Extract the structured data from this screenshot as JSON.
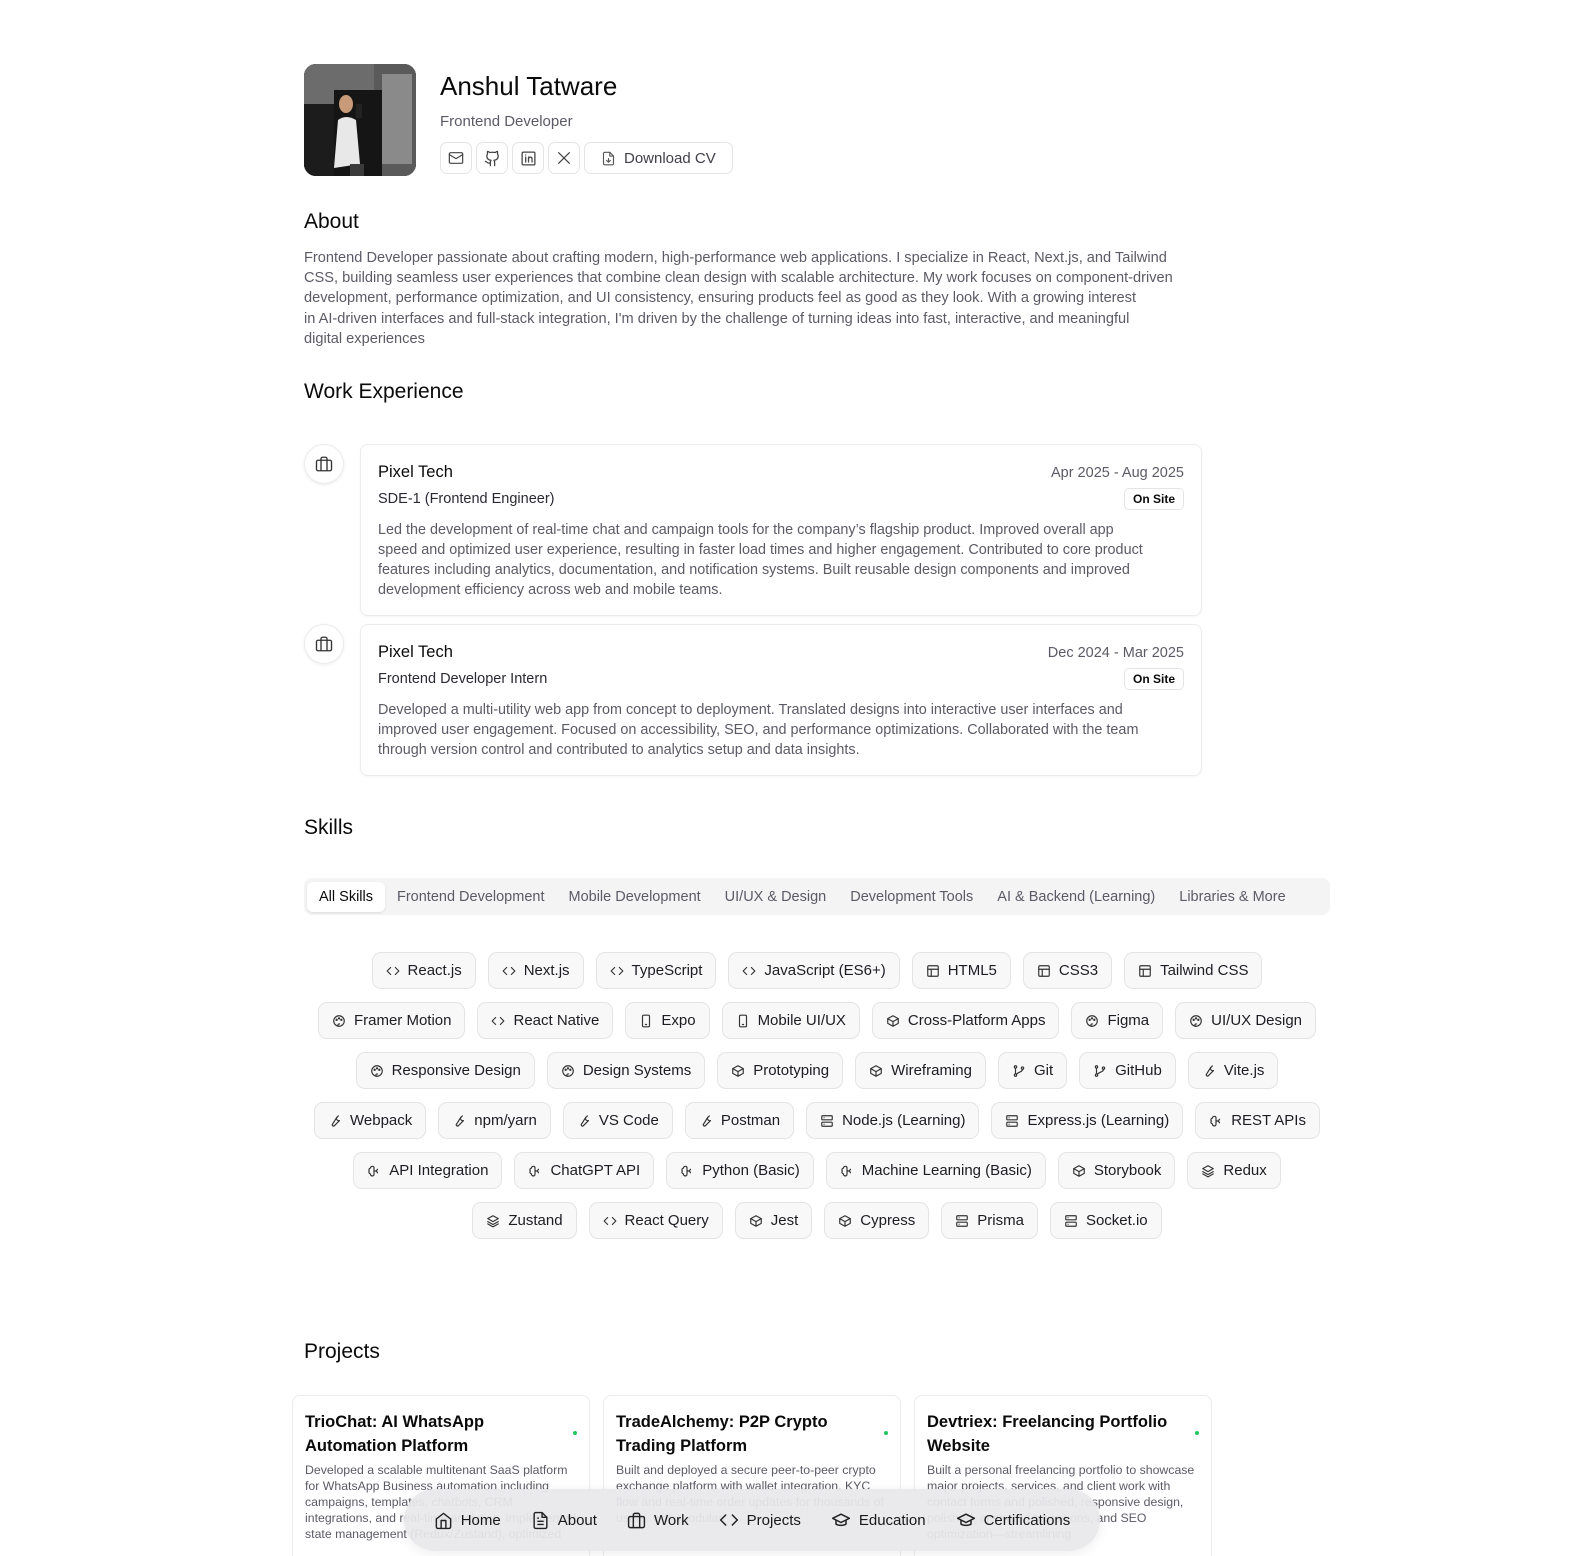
{
  "profile": {
    "name": "Anshul Tatware",
    "role": "Frontend Developer",
    "download_cv": "Download CV",
    "social_icons": [
      "mail-icon",
      "github-icon",
      "linkedin-icon",
      "x-icon"
    ]
  },
  "about": {
    "title": "About",
    "text": "Frontend Developer passionate about crafting modern, high-performance web applications. I specialize in React, Next.js, and Tailwind\nCSS, building seamless user experiences that combine clean design with scalable architecture. My work focuses on component-driven\ndevelopment, performance optimization, and UI consistency, ensuring products feel as good as they look. With a growing interest\nin AI-driven interfaces and full-stack integration, I'm driven by the challenge of turning ideas into fast, interactive, and meaningful\ndigital experiences"
  },
  "work": {
    "title": "Work Experience",
    "items": [
      {
        "company": "Pixel Tech",
        "dates": "Apr 2025 - Aug 2025",
        "position": "SDE-1 (Frontend Engineer)",
        "badge": "On Site",
        "description": "Led the development of real-time chat and campaign tools for the company’s flagship product. Improved overall app\nspeed and optimized user experience, resulting in faster load times and higher engagement. Contributed to core product\nfeatures including analytics, documentation, and notification systems. Built reusable design components and improved\ndevelopment efficiency across web and mobile teams."
      },
      {
        "company": "Pixel Tech",
        "dates": "Dec 2024 - Mar 2025",
        "position": "Frontend Developer Intern",
        "badge": "On Site",
        "description": "Developed a multi-utility web app from concept to deployment. Translated designs into interactive user interfaces and\nimproved user engagement. Focused on accessibility, SEO, and performance optimizations. Collaborated with the team\nthrough version control and contributed to analytics setup and data insights."
      }
    ]
  },
  "skills": {
    "title": "Skills",
    "tabs": [
      "All Skills",
      "Frontend Development",
      "Mobile Development",
      "UI/UX & Design",
      "Development Tools",
      "AI & Backend (Learning)",
      "Libraries & More"
    ],
    "active_tab": "All Skills",
    "items": [
      {
        "label": "React.js",
        "icon": "code"
      },
      {
        "label": "Next.js",
        "icon": "code"
      },
      {
        "label": "TypeScript",
        "icon": "code"
      },
      {
        "label": "JavaScript (ES6+)",
        "icon": "code"
      },
      {
        "label": "HTML5",
        "icon": "layout"
      },
      {
        "label": "CSS3",
        "icon": "layout"
      },
      {
        "label": "Tailwind CSS",
        "icon": "layout"
      },
      {
        "label": "Framer Motion",
        "icon": "palette"
      },
      {
        "label": "React Native",
        "icon": "code"
      },
      {
        "label": "Expo",
        "icon": "phone"
      },
      {
        "label": "Mobile UI/UX",
        "icon": "phone"
      },
      {
        "label": "Cross-Platform Apps",
        "icon": "box"
      },
      {
        "label": "Figma",
        "icon": "palette"
      },
      {
        "label": "UI/UX Design",
        "icon": "palette"
      },
      {
        "label": "Responsive Design",
        "icon": "palette"
      },
      {
        "label": "Design Systems",
        "icon": "palette"
      },
      {
        "label": "Prototyping",
        "icon": "box"
      },
      {
        "label": "Wireframing",
        "icon": "box"
      },
      {
        "label": "Git",
        "icon": "branch"
      },
      {
        "label": "GitHub",
        "icon": "branch"
      },
      {
        "label": "Vite.js",
        "icon": "wrench"
      },
      {
        "label": "Webpack",
        "icon": "wrench"
      },
      {
        "label": "npm/yarn",
        "icon": "wrench"
      },
      {
        "label": "VS Code",
        "icon": "wrench"
      },
      {
        "label": "Postman",
        "icon": "wrench"
      },
      {
        "label": "Node.js (Learning)",
        "icon": "server"
      },
      {
        "label": "Express.js (Learning)",
        "icon": "server"
      },
      {
        "label": "REST APIs",
        "icon": "brain"
      },
      {
        "label": "API Integration",
        "icon": "brain"
      },
      {
        "label": "ChatGPT API",
        "icon": "brain"
      },
      {
        "label": "Python (Basic)",
        "icon": "brain"
      },
      {
        "label": "Machine Learning (Basic)",
        "icon": "brain"
      },
      {
        "label": "Storybook",
        "icon": "box"
      },
      {
        "label": "Redux",
        "icon": "layers"
      },
      {
        "label": "Zustand",
        "icon": "layers"
      },
      {
        "label": "React Query",
        "icon": "code"
      },
      {
        "label": "Jest",
        "icon": "box"
      },
      {
        "label": "Cypress",
        "icon": "box"
      },
      {
        "label": "Prisma",
        "icon": "server"
      },
      {
        "label": "Socket.io",
        "icon": "server"
      }
    ]
  },
  "projects": {
    "title": "Projects",
    "items": [
      {
        "title": "TrioChat: AI WhatsApp Automation Platform",
        "description": "Developed a scalable multitenant SaaS platform for WhatsApp Business automation including campaigns, templates, chatbots, CRM integrations, and real-time analytics. Implemented state management (Redux/Zustand), optimized"
      },
      {
        "title": "TradeAlchemy: P2P Crypto Trading Platform",
        "description": "Built and deployed a secure peer-to-peer crypto exchange platform with wallet integration, KYC flow and real-time order updates for thousands of users, with modular"
      },
      {
        "title": "Devtriex: Freelancing Portfolio Website",
        "description": "Built a personal freelancing portfolio to showcase major projects, services, and client work with contact forms and polished, responsive design, polished, animated transitions, and SEO optimization—streamlining"
      }
    ],
    "status_color": "#22c55e"
  },
  "dock": {
    "items": [
      {
        "label": "Home",
        "icon": "home-icon"
      },
      {
        "label": "About",
        "icon": "file-icon"
      },
      {
        "label": "Work",
        "icon": "briefcase-icon"
      },
      {
        "label": "Projects",
        "icon": "code-icon"
      },
      {
        "label": "Education",
        "icon": "graduation-cap-icon"
      },
      {
        "label": "Certifications",
        "icon": "graduation-cap-icon"
      }
    ]
  }
}
